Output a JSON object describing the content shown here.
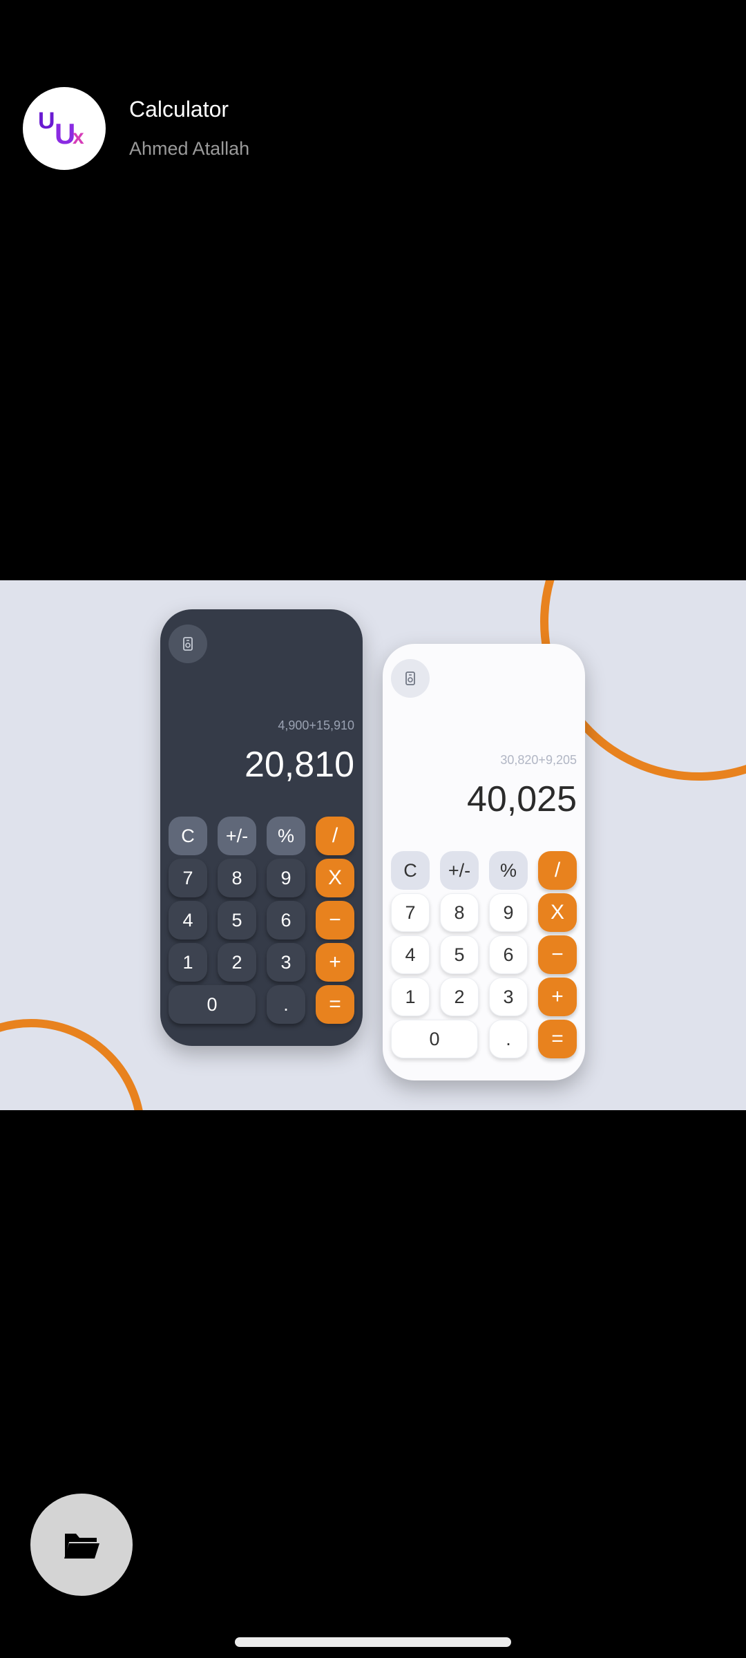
{
  "header": {
    "logo_letters": [
      "U",
      "U",
      "x"
    ],
    "title": "Calculator",
    "author": "Ahmed Atallah"
  },
  "dark_calc": {
    "expression": "4,900+15,910",
    "result": "20,810",
    "keys": [
      "C",
      "+/-",
      "%",
      "/",
      "7",
      "8",
      "9",
      "X",
      "4",
      "5",
      "6",
      "−",
      "1",
      "2",
      "3",
      "+",
      "0",
      ".",
      "="
    ]
  },
  "light_calc": {
    "expression": "30,820+9,205",
    "result": "40,025",
    "keys": [
      "C",
      "+/-",
      "%",
      "/",
      "7",
      "8",
      "9",
      "X",
      "4",
      "5",
      "6",
      "−",
      "1",
      "2",
      "3",
      "+",
      "0",
      ".",
      "="
    ]
  },
  "colors": {
    "accent": "#e8821e",
    "dark_body": "#353b48",
    "light_body": "#fbfbfd",
    "preview_bg": "#dfe2ec"
  },
  "icons": {
    "history": "history-icon",
    "folder": "folder-icon"
  }
}
